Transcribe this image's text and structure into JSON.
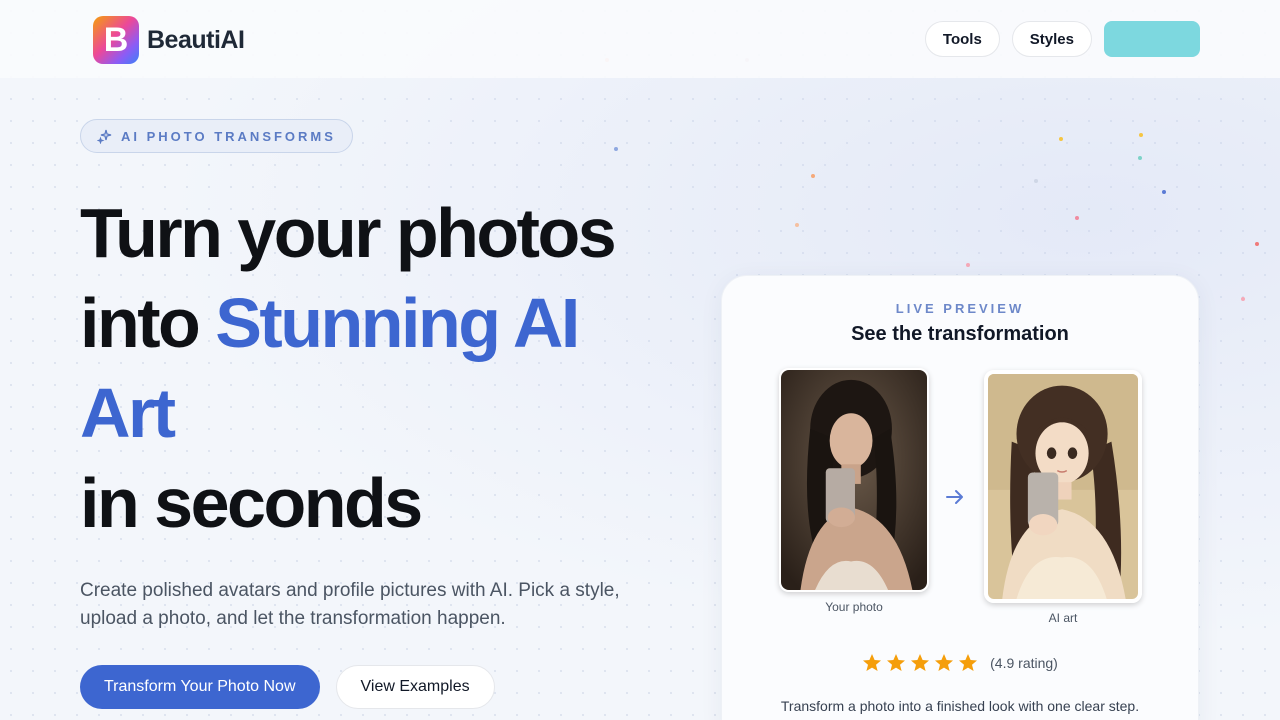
{
  "header": {
    "logo_letter": "B",
    "logo_text": "BeautiAI",
    "nav": [
      {
        "label": "Tools"
      },
      {
        "label": "Styles"
      }
    ],
    "cta_color": "#7dd8df"
  },
  "hero": {
    "badge": "AI PHOTO TRANSFORMS",
    "headline_line1": "Turn your photos",
    "headline_into": "into ",
    "headline_accent1": "Stunning AI",
    "headline_accent2": "Art",
    "headline_line4": "in seconds",
    "subtext": "Create polished avatars and profile pictures with AI. Pick a style, upload a photo, and let the transformation happen.",
    "primary_button": "Transform Your Photo Now",
    "secondary_button": "View Examples",
    "accent_color": "#3d66d0"
  },
  "preview": {
    "kicker": "LIVE PREVIEW",
    "title": "See the transformation",
    "before_caption": "Your photo",
    "after_caption": "AI art",
    "stars": 5,
    "rating_text": "(4.9 rating)",
    "description": "Transform a photo into a finished look with one clear step."
  }
}
